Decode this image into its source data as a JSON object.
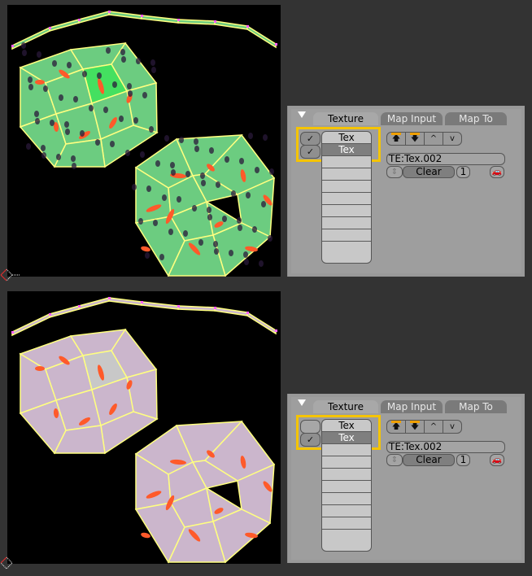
{
  "panels": [
    {
      "tabs": [
        {
          "label": "Texture",
          "active": true
        },
        {
          "label": "Map Input",
          "active": false
        },
        {
          "label": "Map To",
          "active": false
        }
      ],
      "slots": [
        {
          "label": "Tex",
          "enabled": true,
          "selected": false
        },
        {
          "label": "Tex",
          "enabled": true,
          "selected": true
        }
      ],
      "empty_slot_count": 8,
      "texture_name": "TE:Tex.002",
      "clear_label": "Clear",
      "users_count": "1",
      "move_buttons": [
        "move-top",
        "move-bottom",
        "move-up",
        "move-down"
      ]
    },
    {
      "tabs": [
        {
          "label": "Texture",
          "active": true
        },
        {
          "label": "Map Input",
          "active": false
        },
        {
          "label": "Map To",
          "active": false
        }
      ],
      "slots": [
        {
          "label": "Tex",
          "enabled": false,
          "selected": false
        },
        {
          "label": "Tex",
          "enabled": true,
          "selected": true
        }
      ],
      "empty_slot_count": 8,
      "texture_name": "TE:Tex.002",
      "clear_label": "Clear",
      "users_count": "1",
      "move_buttons": [
        "move-top",
        "move-bottom",
        "move-up",
        "move-down"
      ]
    }
  ],
  "icons": {
    "checkmark": "✓",
    "up": "^",
    "down": "v",
    "move_top": "⬆",
    "move_bottom": "⬇",
    "spinner": "⇕",
    "fake_user": "car-icon"
  },
  "colors": {
    "highlight": "#f5c400",
    "mesh_top": "#6ccc80",
    "mesh_bottom": "#cbb6cc",
    "mesh_edges": "#ffff80",
    "face_selected_top": "#44e060",
    "face_selected_bottom": "#c8c8c8",
    "texture_spots": "#ff5a2a",
    "dots": "#2a1a3a"
  }
}
